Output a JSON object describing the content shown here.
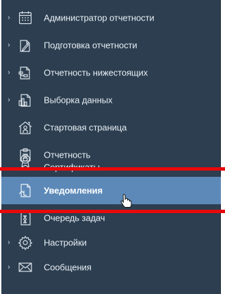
{
  "menu": {
    "items": [
      {
        "label": "Администратор отчетности",
        "icon": "calendar-icon",
        "expandable": true
      },
      {
        "label": "Подготовка отчетности",
        "icon": "document-pen-icon",
        "expandable": true
      },
      {
        "label": "Отчетность нижестоящих",
        "icon": "document-hierarchy-icon",
        "expandable": true
      },
      {
        "label": "Выборка данных",
        "icon": "document-chart-icon",
        "expandable": true
      },
      {
        "label": "Стартовая страница",
        "icon": "home-icon",
        "expandable": false
      },
      {
        "label": "Отчетность",
        "icon": "clipboard-icon",
        "expandable": false
      },
      {
        "label": "Сертификаты",
        "icon": "certificate-icon",
        "expandable": false
      },
      {
        "label": "Уведомления",
        "icon": "notification-document-icon",
        "expandable": false,
        "active": true
      },
      {
        "label": "Очередь задач",
        "icon": "hourglass-document-icon",
        "expandable": false
      },
      {
        "label": "Настройки",
        "icon": "gear-icon",
        "expandable": true
      },
      {
        "label": "Сообщения",
        "icon": "envelope-icon",
        "expandable": true
      }
    ]
  },
  "colors": {
    "sidebar_bg": "#2c3e50",
    "active_bg": "#5c89b8",
    "text": "#e8eef3",
    "annotation_red": "#e8090c"
  }
}
